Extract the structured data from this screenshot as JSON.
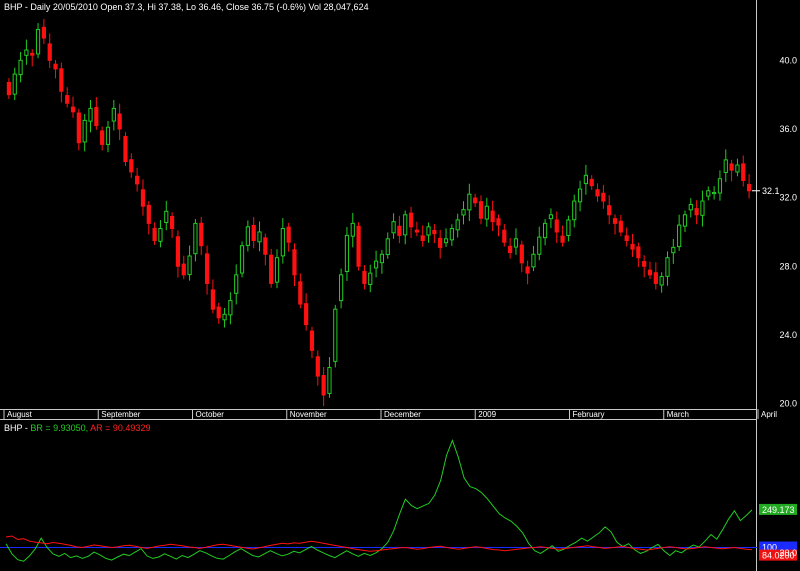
{
  "header": {
    "main": "BHP - Daily 20/05/2010 Open 37.3, Hi 37.38, Lo 36.46, Close 36.75 (-0.6%) Vol 28,047,624",
    "ind_prefix": "BHP - ",
    "ind_br": "BR = 9.93050,",
    "ind_ar": "AR = 90.49329"
  },
  "chart_data": [
    {
      "type": "candlestick",
      "title": "BHP - Daily 20/05/2010 Open 37.3, Hi 37.38, Lo 36.46, Close 36.75 (-0.6%) Vol 28,047,624",
      "x_tick_labels": [
        "August",
        "September",
        "October",
        "November",
        "December",
        "2009",
        "February",
        "March",
        "April"
      ],
      "y_tick_labels": [
        "20.0",
        "24.0",
        "28.0",
        "32.0",
        "36.0",
        "40.0"
      ],
      "ylim": [
        19.8,
        42.7
      ],
      "last_price_label": "32.1",
      "up_color": "#22cc22",
      "down_color": "#ff1111",
      "closes": [
        38.0,
        39.2,
        40.0,
        40.6,
        40.3,
        41.8,
        41.3,
        40.0,
        39.5,
        38.2,
        37.5,
        37.0,
        35.2,
        36.5,
        37.2,
        36.2,
        35.1,
        36.1,
        37.2,
        36.0,
        34.1,
        33.5,
        32.8,
        31.5,
        30.5,
        29.5,
        30.2,
        31.2,
        30.2,
        28.0,
        27.5,
        28.6,
        30.5,
        29.2,
        27.0,
        25.5,
        25.0,
        25.2,
        26.0,
        27.5,
        29.2,
        30.3,
        29.5,
        30.0,
        28.7,
        27.0,
        28.5,
        30.2,
        29.4,
        27.5,
        25.8,
        24.6,
        23.1,
        21.6,
        20.5,
        22.1,
        25.5,
        27.5,
        29.8,
        30.5,
        28.0,
        27.0,
        27.6,
        28.3,
        28.7,
        29.6,
        30.6,
        29.8,
        31.0,
        30.3,
        30.0,
        29.5,
        30.3,
        29.9,
        29.1,
        29.6,
        30.2,
        30.7,
        31.3,
        32.2,
        31.7,
        30.8,
        31.5,
        30.6,
        30.4,
        29.4,
        28.8,
        29.6,
        28.2,
        27.6,
        28.7,
        29.7,
        30.5,
        31.0,
        30.0,
        29.4,
        30.7,
        31.8,
        32.5,
        33.3,
        32.7,
        32.1,
        31.8,
        31.0,
        30.5,
        30.0,
        29.5,
        29.0,
        28.5,
        28.0,
        27.5,
        27.0,
        27.4,
        28.5,
        29.1,
        30.4,
        31.0,
        31.6,
        31.0,
        31.8,
        32.4,
        32.3,
        33.1,
        34.2,
        33.6,
        33.9,
        33.0,
        32.4
      ]
    },
    {
      "type": "line",
      "title": "BHP - BR = 9.93050, AR = 90.49329",
      "series": [
        {
          "name": "BR",
          "color": "#22cc22",
          "values": [
            118,
            70,
            42,
            35,
            60,
            95,
            145,
            100,
            70,
            58,
            72,
            52,
            60,
            48,
            58,
            78,
            65,
            48,
            40,
            55,
            68,
            62,
            78,
            95,
            60,
            48,
            55,
            70,
            58,
            45,
            62,
            52,
            68,
            85,
            75,
            60,
            48,
            45,
            62,
            80,
            95,
            78,
            62,
            55,
            70,
            85,
            72,
            60,
            68,
            82,
            75,
            90,
            105,
            88,
            75,
            62,
            52,
            68,
            85,
            70,
            58,
            72,
            62,
            75,
            95,
            125,
            180,
            260,
            330,
            300,
            285,
            298,
            310,
            350,
            420,
            540,
            610,
            530,
            430,
            390,
            380,
            360,
            330,
            295,
            260,
            240,
            225,
            200,
            168,
            118,
            85,
            72,
            90,
            108,
            82,
            92,
            110,
            125,
            145,
            130,
            150,
            170,
            198,
            175,
            125,
            105,
            118,
            90,
            72,
            82,
            100,
            115,
            85,
            62,
            85,
            75,
            95,
            112,
            102,
            130,
            162,
            140,
            185,
            235,
            275,
            228,
            252,
            279
          ]
        },
        {
          "name": "AR",
          "color": "#ff1111",
          "values": [
            150,
            155,
            138,
            142,
            130,
            126,
            122,
            118,
            124,
            120,
            116,
            110,
            103,
            100,
            106,
            112,
            108,
            104,
            100,
            103,
            108,
            111,
            106,
            100,
            96,
            101,
            107,
            111,
            116,
            112,
            108,
            103,
            100,
            96,
            101,
            107,
            113,
            116,
            111,
            106,
            101,
            97,
            93,
            98,
            104,
            110,
            115,
            120,
            117,
            122,
            120,
            125,
            130,
            126,
            120,
            115,
            110,
            105,
            100,
            95,
            90,
            86,
            82,
            85,
            88,
            92,
            95,
            98,
            100,
            96,
            92,
            95,
            100,
            104,
            106,
            100,
            96,
            92,
            96,
            100,
            104,
            100,
            95,
            90,
            88,
            85,
            88,
            92,
            95,
            98,
            100,
            104,
            100,
            96,
            92,
            95,
            98,
            102,
            105,
            108,
            104,
            100,
            96,
            99,
            102,
            105,
            100,
            95,
            92,
            88,
            92,
            96,
            100,
            104,
            100,
            96,
            93,
            96,
            100,
            104,
            100,
            97,
            94,
            97,
            100,
            96,
            92,
            90
          ]
        }
      ],
      "reference_line": {
        "value": 100,
        "color": "#1a2bff",
        "label": "100"
      },
      "y_tick_labels": [
        "20.0"
      ],
      "last_value_labels": {
        "BR": "249.173",
        "AR": "84.0200"
      },
      "ylim": [
        12,
        650
      ]
    }
  ]
}
